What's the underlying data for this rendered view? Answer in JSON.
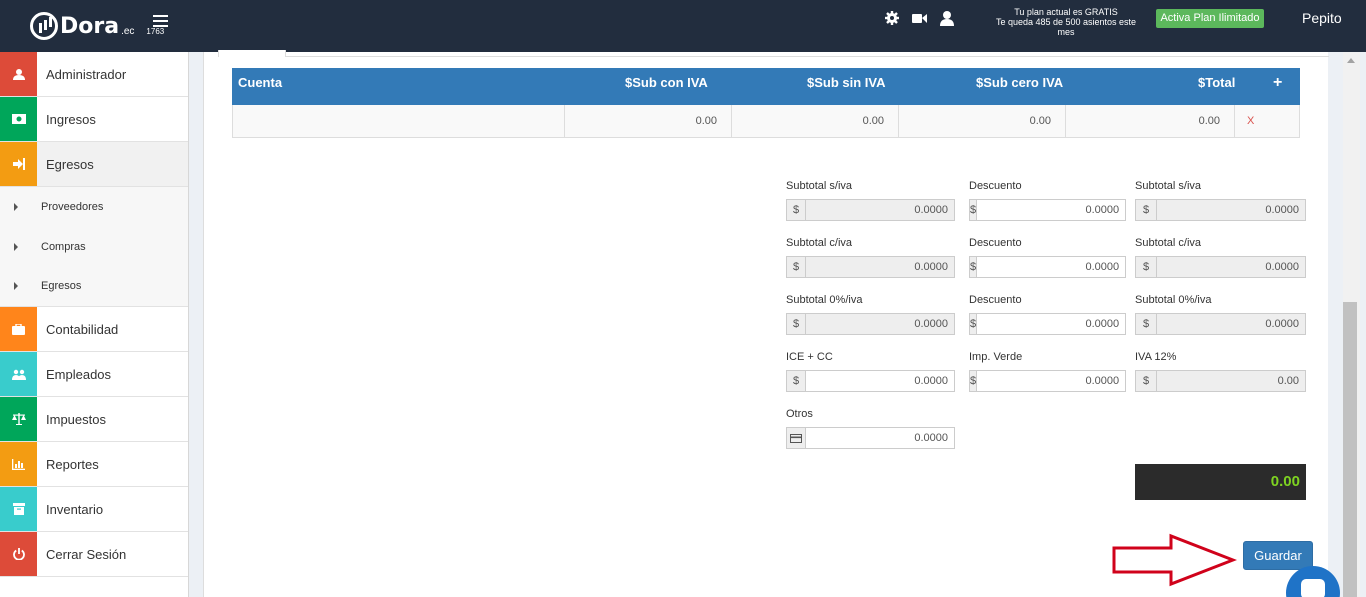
{
  "header": {
    "logo_name": "Dora",
    "logo_suffix": ".ec",
    "logo_number": "1763",
    "plan_line1": "Tu plan actual es GRATIS",
    "plan_line2": "Te queda 485 de 500 asientos este mes",
    "plan_button": "Activa Plan Ilimitado",
    "user_name": "Pepito"
  },
  "sidebar": {
    "items": [
      {
        "label": "Administrador",
        "color": "#dd4b39",
        "icon": "user-icon"
      },
      {
        "label": "Ingresos",
        "color": "#00a65a",
        "icon": "money-icon"
      },
      {
        "label": "Egresos",
        "color": "#f39c12",
        "icon": "sign-in-icon"
      }
    ],
    "subitems": [
      "Proveedores",
      "Compras",
      "Egresos"
    ],
    "items_after": [
      {
        "label": "Contabilidad",
        "color": "#ff851b",
        "icon": "briefcase-icon"
      },
      {
        "label": "Empleados",
        "color": "#39cccc",
        "icon": "users-icon"
      },
      {
        "label": "Impuestos",
        "color": "#00a65a",
        "icon": "balance-icon"
      },
      {
        "label": "Reportes",
        "color": "#f39c12",
        "icon": "bar-chart-icon"
      },
      {
        "label": "Inventario",
        "color": "#39cccc",
        "icon": "box-icon"
      },
      {
        "label": "Cerrar Sesión",
        "color": "#dd4b39",
        "icon": "power-icon"
      }
    ]
  },
  "table": {
    "headers": [
      "Cuenta",
      "$Sub con IVA",
      "$Sub sin IVA",
      "$Sub cero IVA",
      "$Total",
      "+"
    ],
    "row": {
      "cuenta": "",
      "sub_con_iva": "0.00",
      "sub_sin_iva": "0.00",
      "sub_cero_iva": "0.00",
      "total": "0.00",
      "delete": "X"
    }
  },
  "form": {
    "currency": "$",
    "subtotal_siva_label": "Subtotal s/iva",
    "subtotal_siva_value": "0.0000",
    "descuento_label": "Descuento",
    "descuento1_value": "0.0000",
    "subtotal_siva2_value": "0.0000",
    "subtotal_civa_label": "Subtotal c/iva",
    "subtotal_civa_value": "0.0000",
    "descuento2_value": "0.0000",
    "subtotal_civa2_value": "0.0000",
    "subtotal_0iva_label": "Subtotal 0%/iva",
    "subtotal_0iva_value": "0.0000",
    "descuento3_value": "0.0000",
    "subtotal_0iva2_value": "0.0000",
    "ice_label": "ICE + CC",
    "ice_value": "0.0000",
    "imp_verde_label": "Imp. Verde",
    "imp_verde_value": "0.0000",
    "iva_label": "IVA 12%",
    "iva_value": "0.00",
    "otros_label": "Otros",
    "otros_value": "0.0000"
  },
  "total": "0.00",
  "actions": {
    "save_label": "Guardar"
  },
  "colors": {
    "header": "#222d3e",
    "primary": "#337ab7",
    "success": "#5cb85c",
    "annotation": "#d0021b",
    "total_text": "#7ed321"
  }
}
